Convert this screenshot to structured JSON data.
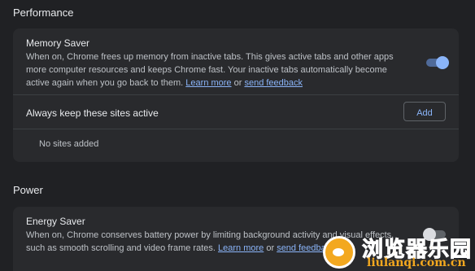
{
  "performance": {
    "section_title": "Performance",
    "memory_saver": {
      "title": "Memory Saver",
      "description": "When on, Chrome frees up memory from inactive tabs. This gives active tabs and other apps more computer resources and keeps Chrome fast. Your inactive tabs automatically become active again when you go back to them.",
      "learn_more": "Learn more",
      "or": "or",
      "send_feedback": "send feedback",
      "toggle_state": "on"
    },
    "always_active": {
      "title": "Always keep these sites active",
      "add_label": "Add",
      "empty_text": "No sites added"
    }
  },
  "power": {
    "section_title": "Power",
    "energy_saver": {
      "title": "Energy Saver",
      "description": "When on, Chrome conserves battery power by limiting background activity and visual effects, such as smooth scrolling and video frame rates.",
      "learn_more": "Learn more",
      "or": "or",
      "send_feedback": "send feedback",
      "toggle_state": "off"
    }
  },
  "watermark": {
    "cn": "浏览器乐园",
    "en": "liulanqi.com.cn"
  },
  "colors": {
    "background": "#202124",
    "card": "#292a2d",
    "accent": "#8ab4f8",
    "watermark": "#f3a81f"
  }
}
